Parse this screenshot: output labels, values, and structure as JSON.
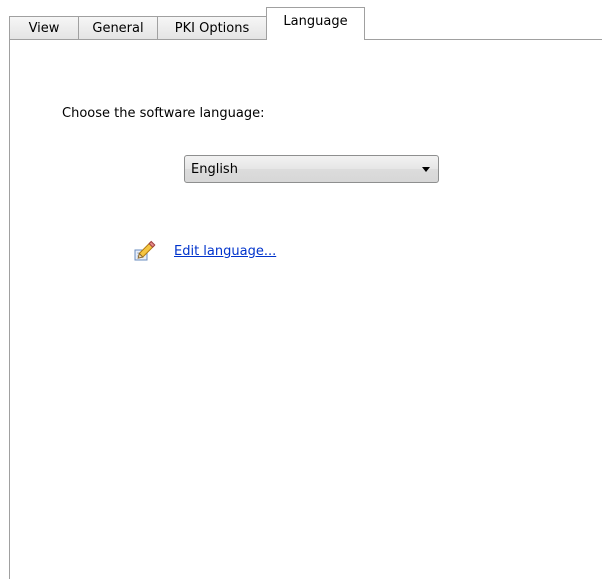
{
  "tabs": [
    {
      "label": "View",
      "active": false
    },
    {
      "label": "General",
      "active": false
    },
    {
      "label": "PKI Options",
      "active": false
    },
    {
      "label": "Language",
      "active": true
    }
  ],
  "language": {
    "prompt": "Choose the software language:",
    "selected": "English",
    "edit_link": "Edit language...",
    "edit_icon": "edit-pencil-icon"
  },
  "colors": {
    "link": "#0033cc",
    "border": "#a0a0a0"
  }
}
